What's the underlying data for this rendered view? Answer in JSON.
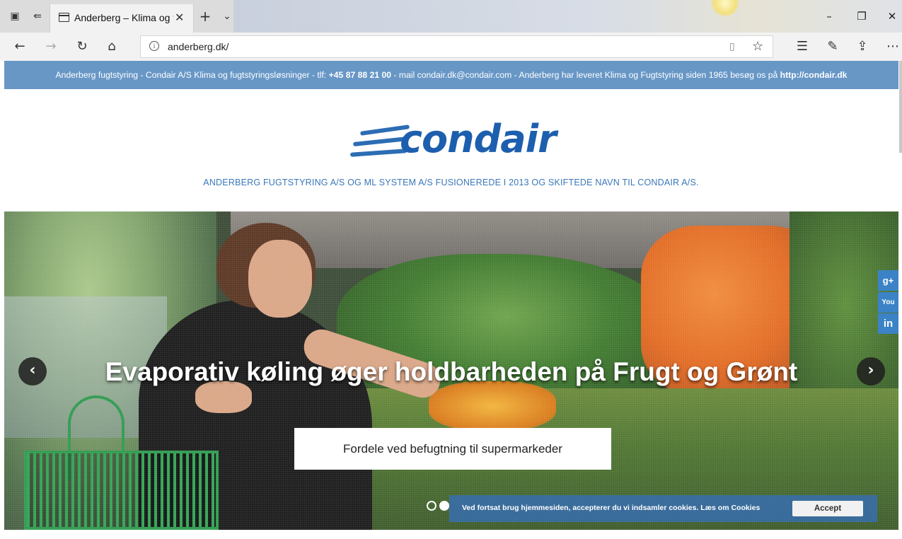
{
  "browser": {
    "tab_title": "Anderberg – Klima og fugtstyring",
    "url": "anderberg.dk/",
    "icons": [
      "tab-preview-icon",
      "set-aside-tabs-icon",
      "page-icon",
      "close-icon",
      "new-tab-icon",
      "chevron-down-icon",
      "minimize-icon",
      "restore-icon",
      "window-close-icon",
      "back-icon",
      "forward-icon",
      "refresh-icon",
      "home-icon",
      "info-icon",
      "reading-view-icon",
      "favorite-star-icon",
      "favorites-hub-icon",
      "pen-icon",
      "share-icon",
      "more-icon"
    ]
  },
  "infobar": {
    "text_before_phone": "Anderberg fugtstyring - Condair A/S Klima og fugtstyringsløsninger - tlf: ",
    "phone": "+45 87 88 21 00",
    "text_after_phone": " - mail condair.dk@condair.com - Anderberg har leveret Klima og Fugtstyring siden 1965 besøg os på ",
    "link": "http://condair.dk"
  },
  "logo": {
    "wordmark": "condair",
    "brand_color": "#1d5fae"
  },
  "tagline": "ANDERBERG FUGTSTYRING A/S OG ML SYSTEM A/S FUSIONEREDE I 2013 OG SKIFTEDE NAVN TIL CONDAIR A/S.",
  "hero": {
    "headline": "Evaporativ køling øger holdbarheden på Frugt og Grønt",
    "cta_label": "Fordele ved befugtning til supermarkeder",
    "prev_symbol": "‹",
    "next_symbol": "›"
  },
  "social": {
    "gplus": "g+",
    "youtube": "You",
    "linkedin": "in"
  },
  "cookie": {
    "text": "Ved fortsat brug hjemmesiden, accepterer du vi indsamler cookies. Læs om Cookies",
    "accept_label": "Accept"
  },
  "colors": {
    "infobar": "#6897c6",
    "tagline": "#3a78b8",
    "social": "#3b83c6",
    "cookie_bar": "#3a6ea5"
  }
}
